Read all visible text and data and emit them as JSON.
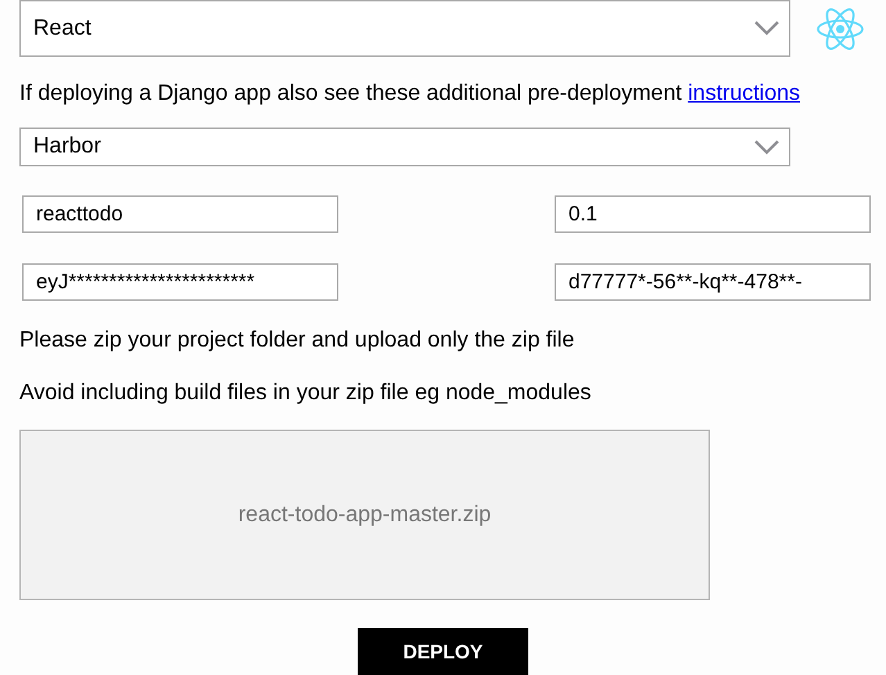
{
  "framework_select": {
    "value": "React"
  },
  "notice": {
    "text": "If deploying a Django app also see these additional pre-deployment",
    "link": "instructions"
  },
  "registry_select": {
    "value": "Harbor"
  },
  "fields": [
    {
      "value": "reacttodo"
    },
    {
      "value": "0.1"
    },
    {
      "value": "eyJ***********************"
    },
    {
      "value": "d77777*-56**-kq**-478**-"
    }
  ],
  "hints": [
    "Please zip your project folder and upload only the zip file",
    "Avoid including build files in your zip file eg node_modules"
  ],
  "dropzone": {
    "file": "react-todo-app-master.zip"
  },
  "deploy_button": {
    "label": "DEPLOY"
  }
}
